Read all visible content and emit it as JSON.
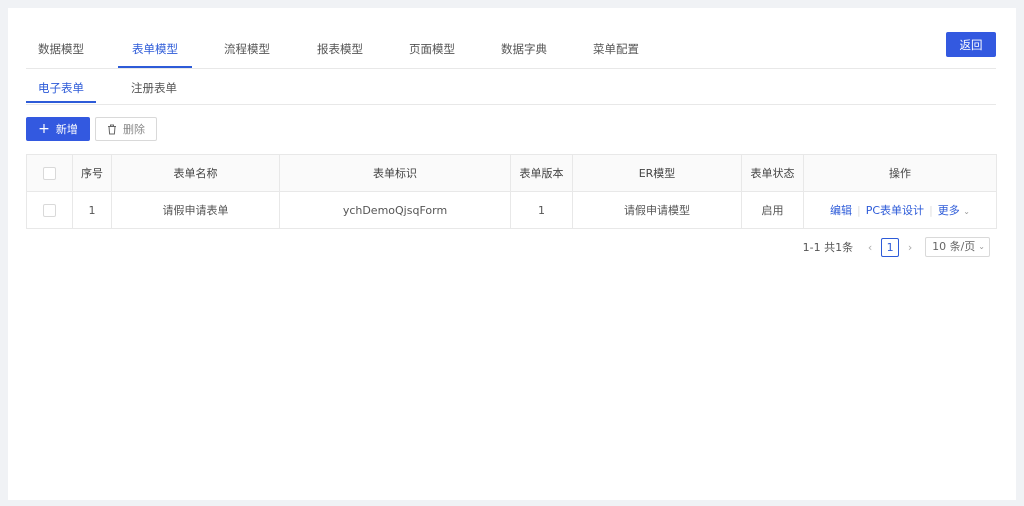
{
  "top_tabs": [
    "数据模型",
    "表单模型",
    "流程模型",
    "报表模型",
    "页面模型",
    "数据字典",
    "菜单配置"
  ],
  "active_top_tab": "表单模型",
  "back_label": "返回",
  "sub_tabs": [
    "电子表单",
    "注册表单"
  ],
  "toolbar": {
    "add_label": "新增",
    "delete_label": "删除"
  },
  "table": {
    "headers": [
      "序号",
      "表单名称",
      "表单标识",
      "表单版本",
      "ER模型",
      "表单状态",
      "操作"
    ],
    "rows": [
      {
        "index": "1",
        "name": "请假申请表单",
        "code": "ychDemoQjsqForm",
        "version": "1",
        "er_model": "请假申请模型",
        "status": "启用",
        "actions": {
          "edit": "编辑",
          "design": "PC表单设计",
          "more": "更多"
        }
      }
    ]
  },
  "pagination": {
    "total": "1-1 共1条",
    "current_page": "1",
    "page_size": "10 条/页"
  },
  "colors": {
    "accent": "#3359e0",
    "link": "#2d5bd8"
  }
}
